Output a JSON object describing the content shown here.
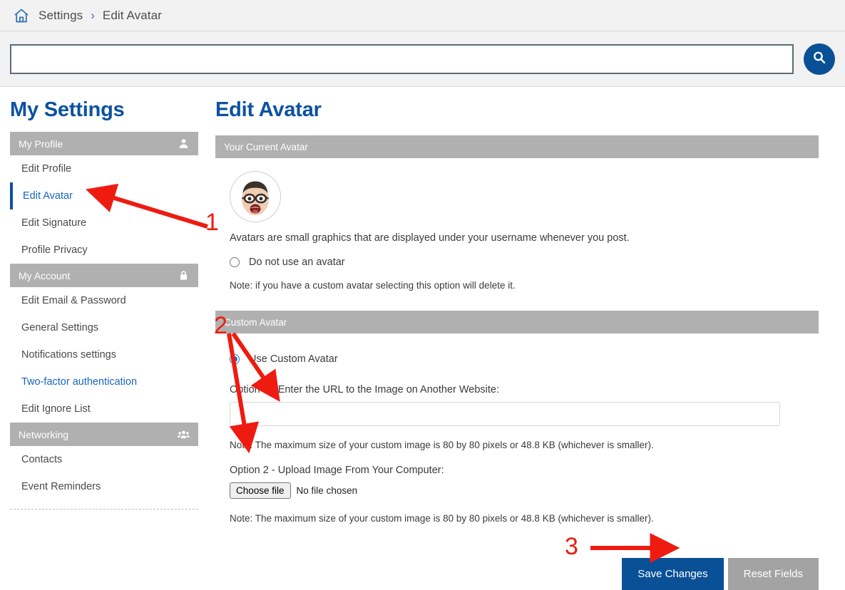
{
  "breadcrumb": {
    "home_icon": "home-icon",
    "items": [
      "Settings",
      "Edit Avatar"
    ],
    "separator": "›"
  },
  "search": {
    "value": "",
    "placeholder": "",
    "button_icon": "search-icon"
  },
  "sidebar": {
    "title": "My Settings",
    "groups": [
      {
        "label": "My Profile",
        "icon": "user-icon",
        "items": [
          {
            "label": "Edit Profile",
            "state": "normal"
          },
          {
            "label": "Edit Avatar",
            "state": "active"
          },
          {
            "label": "Edit Signature",
            "state": "normal"
          },
          {
            "label": "Profile Privacy",
            "state": "normal"
          }
        ]
      },
      {
        "label": "My Account",
        "icon": "lock-icon",
        "items": [
          {
            "label": "Edit Email & Password",
            "state": "normal"
          },
          {
            "label": "General Settings",
            "state": "normal"
          },
          {
            "label": "Notifications settings",
            "state": "normal"
          },
          {
            "label": "Two-factor authentication",
            "state": "link"
          },
          {
            "label": "Edit Ignore List",
            "state": "normal"
          }
        ]
      },
      {
        "label": "Networking",
        "icon": "people-icon",
        "items": [
          {
            "label": "Contacts",
            "state": "normal"
          },
          {
            "label": "Event Reminders",
            "state": "normal"
          }
        ]
      }
    ]
  },
  "main": {
    "title": "Edit Avatar",
    "current_avatar_panel": {
      "header": "Your Current Avatar",
      "avatar_icon": "memoji-avatar",
      "description": "Avatars are small graphics that are displayed under your username whenever you post.",
      "no_avatar_radio": {
        "label": "Do not use an avatar",
        "checked": false
      },
      "no_avatar_note": "Note: if you have a custom avatar selecting this option will delete it."
    },
    "custom_avatar_panel": {
      "header": "Custom Avatar",
      "use_custom_radio": {
        "label": "Use Custom Avatar",
        "checked": true
      },
      "option1_label": "Option 1 - Enter the URL to the Image on Another Website:",
      "url_value": "",
      "url_placeholder": "",
      "note1": "Note: The maximum size of your custom image is 80 by 80 pixels or 48.8 KB (whichever is smaller).",
      "option2_label": "Option 2 - Upload Image From Your Computer:",
      "file_button": "Choose file",
      "file_status": "No file chosen",
      "note2": "Note: The maximum size of your custom image is 80 by 80 pixels or 48.8 KB (whichever is smaller)."
    },
    "buttons": {
      "save": "Save Changes",
      "reset": "Reset Fields"
    }
  },
  "annotations": {
    "color": "#ee1b11",
    "markers": [
      {
        "number": "1",
        "target": "sidebar-item-edit-avatar"
      },
      {
        "number": "2",
        "target": "custom-avatar-inputs"
      },
      {
        "number": "3",
        "target": "save-changes-button"
      }
    ]
  },
  "colors": {
    "brand_blue": "#0b52a1",
    "button_blue": "#0a5096",
    "link_blue": "#1566c0",
    "section_gray": "#b0b0b0",
    "reset_gray": "#a3a3a3",
    "annotation_red": "#ee1b11"
  }
}
